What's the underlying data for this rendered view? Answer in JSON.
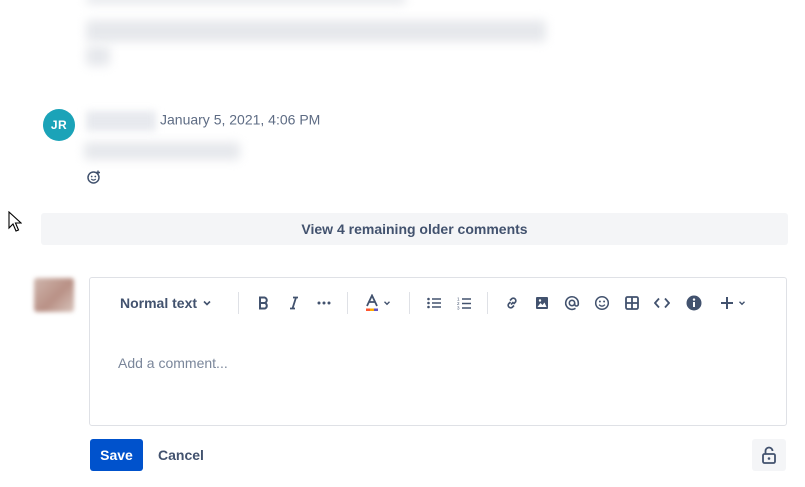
{
  "comment": {
    "avatar_initials": "JR",
    "timestamp": "January 5, 2021, 4:06 PM"
  },
  "older_comments_label": "View 4 remaining older comments",
  "editor": {
    "format_label": "Normal text",
    "placeholder": "Add a comment...",
    "toolbar_icons": [
      "bold-icon",
      "italic-icon",
      "more-formatting-icon",
      "text-color-icon",
      "bullet-list-icon",
      "numbered-list-icon",
      "link-icon",
      "image-icon",
      "mention-icon",
      "emoji-icon",
      "table-icon",
      "code-icon",
      "info-icon",
      "insert-plus-icon"
    ]
  },
  "actions": {
    "save_label": "Save",
    "cancel_label": "Cancel"
  },
  "colors": {
    "primary": "#0052cc",
    "avatar_teal": "#1ba3b8",
    "text_subtle": "#5e6c84"
  }
}
